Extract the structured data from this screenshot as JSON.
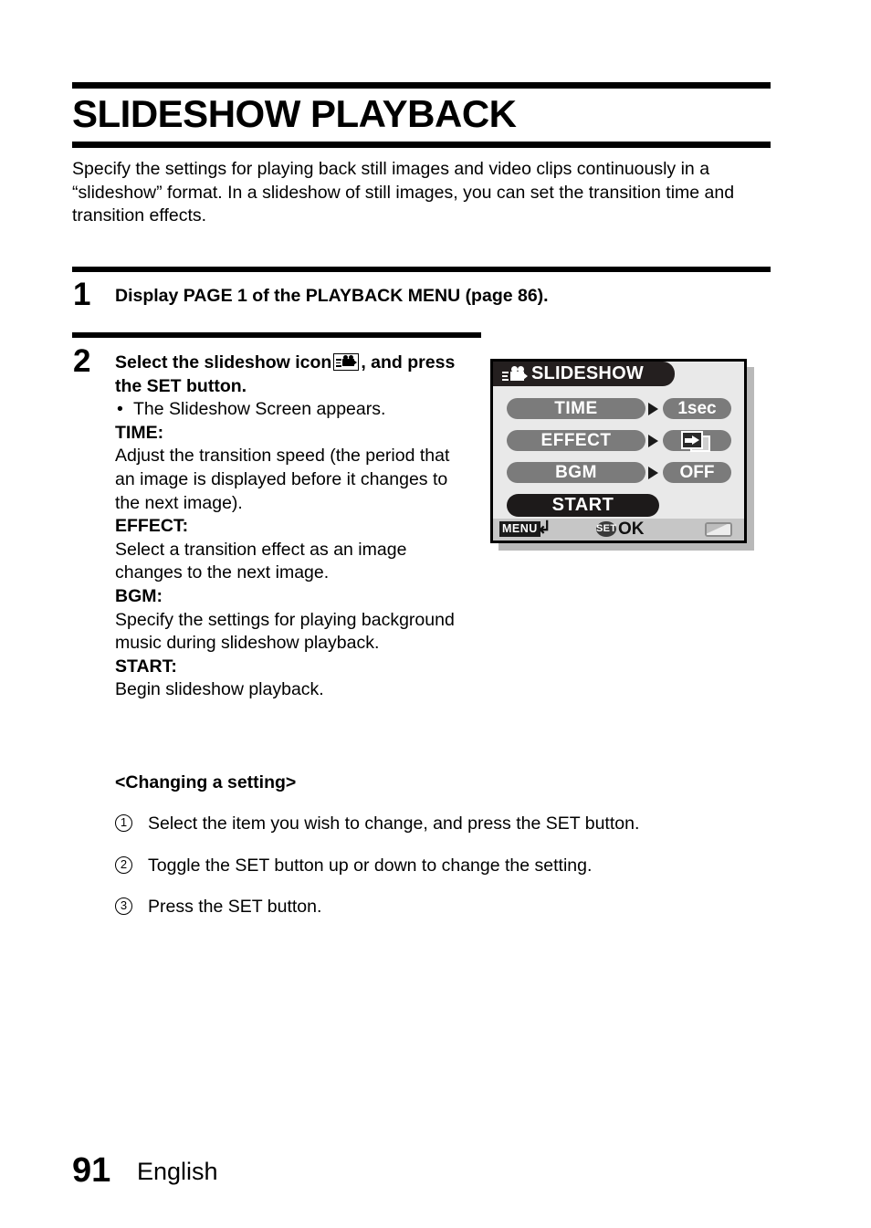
{
  "document": {
    "title": "SLIDESHOW PLAYBACK",
    "intro": "Specify the settings for playing back still images and video clips continuously in a “slideshow” format. In a slideshow of still images, you can set the transition time and transition effects."
  },
  "steps": [
    {
      "number": "1",
      "text": "Display PAGE 1 of the PLAYBACK MENU (page 86)."
    },
    {
      "number": "2",
      "heading_before_icon": "Select the slideshow icon",
      "heading_icon": "slideshow-camera-icon",
      "heading_after_icon": ", and press the SET button.",
      "bullet": "The Slideshow Screen appears.",
      "bullet_marker": "•",
      "definitions": [
        {
          "term": "TIME:",
          "desc": "Adjust the transition speed (the period that an image is displayed before it changes to the next image)."
        },
        {
          "term": "EFFECT:",
          "desc": "Select a transition effect as an image changes to the next image."
        },
        {
          "term": "BGM:",
          "desc": "Specify the settings for playing background music during slideshow playback."
        },
        {
          "term": "START:",
          "desc": "Begin slideshow playback."
        }
      ]
    }
  ],
  "changing_a_setting": {
    "heading": "<Changing a setting>",
    "items": [
      {
        "marker": "①",
        "marker_text": "1",
        "text": "Select the item you wish to change, and press the SET button."
      },
      {
        "marker": "②",
        "marker_text": "2",
        "text": "Toggle the SET button up or down to change the setting."
      },
      {
        "marker": "③",
        "marker_text": "3",
        "text": "Press the SET button."
      }
    ]
  },
  "lcd_screen": {
    "title": "SLIDESHOW",
    "title_icon": "movie-camera-icon",
    "rows": [
      {
        "label": "TIME",
        "arrow": "▶",
        "value": "1sec",
        "value_type": "text"
      },
      {
        "label": "EFFECT",
        "arrow": "▶",
        "value": "",
        "value_type": "transition-effect-icon"
      },
      {
        "label": "BGM",
        "arrow": "▶",
        "value": "OFF",
        "value_type": "text"
      }
    ],
    "start_button": "START",
    "status_bar": {
      "menu_label": "MENU",
      "return_glyph": "↲",
      "set_label": "SET",
      "ok_label": "OK",
      "battery_icon": "battery-icon"
    },
    "colors": {
      "screen_bg": "#e9e9e9",
      "pill": "#7b7b7b",
      "selected": "#1d1a1a",
      "title_bar": "#241f1f",
      "status_bar": "#c6c6c6",
      "text": "#ffffff"
    }
  },
  "footer": {
    "page_number": "91",
    "language": "English"
  }
}
